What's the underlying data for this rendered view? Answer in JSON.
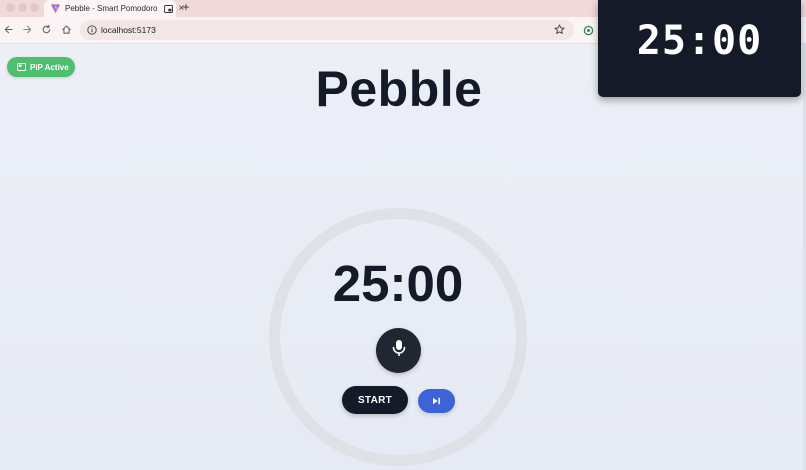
{
  "browser": {
    "tab": {
      "title": "Pebble - Smart Pomodoro",
      "favicon": "vite-logo-icon",
      "pip_indicator": "pip-tab-icon",
      "close_label": "×"
    },
    "new_tab_label": "+",
    "address_bar": {
      "url": "localhost:5173"
    }
  },
  "app": {
    "title": "Pebble",
    "pip_badge": "PiP Active",
    "timer": "25:00",
    "start_label": "START",
    "colors": {
      "pip_badge": "#4fbe6f",
      "skip_button": "#3d63d9",
      "dark": "#141a27",
      "ring": "#dfe1e6"
    }
  },
  "pip_window": {
    "timer": "25:00"
  }
}
